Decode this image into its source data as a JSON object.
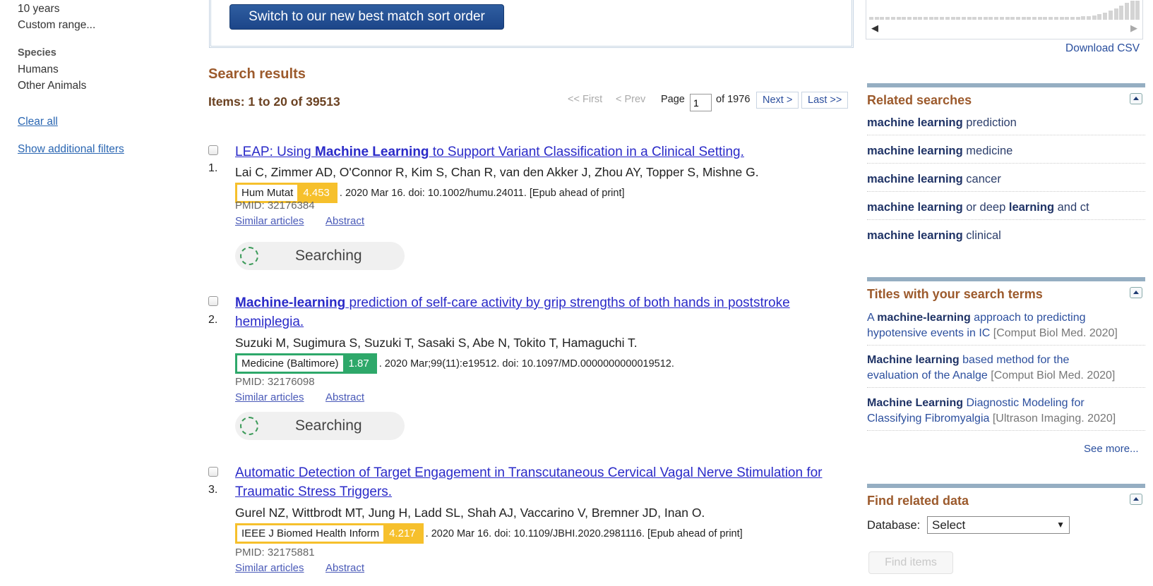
{
  "sidebar": {
    "years_10": "10 years",
    "custom_range": "Custom range...",
    "species_heading": "Species",
    "species_humans": "Humans",
    "species_other": "Other Animals",
    "clear_all": "Clear all",
    "show_filters": "Show additional filters"
  },
  "banner": {
    "button": "Switch to our new best match sort order"
  },
  "results": {
    "heading": "Search results",
    "count": "Items: 1 to 20 of 39513",
    "pager": {
      "first": "<< First",
      "prev": "< Prev",
      "page_label": "Page",
      "page_value": "1",
      "of_total": "of 1976",
      "next": "Next >",
      "last": "Last >>"
    },
    "similar_label": "Similar articles",
    "abstract_label": "Abstract",
    "searching_label": "Searching",
    "items": [
      {
        "num": "1.",
        "title_pre": "LEAP: Using ",
        "title_bold": "Machine Learning",
        "title_line1_post": " to Support Variant Classification in a Clinical Setting.",
        "authors": "Lai C, Zimmer AD, O'Connor R, Kim S, Chan R, van den Akker J, Zhou AY, Topper S, Mishne G.",
        "journal": "Hum Mutat",
        "score": "4.453",
        "citation": ". 2020 Mar 16. doi: 10.1002/humu.24011. [Epub ahead of print]",
        "pmid": "PMID: 32176384"
      },
      {
        "num": "2.",
        "title_bold": "Machine-learning",
        "title_line1_post": " prediction of self-care activity by grip strengths of both hands in poststroke",
        "title_line2": "hemiplegia.",
        "authors": "Suzuki M, Sugimura S, Suzuki T, Sasaki S, Abe N, Tokito T, Hamaguchi T.",
        "journal": "Medicine (Baltimore)",
        "score": "1.87",
        "citation": ". 2020 Mar;99(11):e19512. doi: 10.1097/MD.0000000000019512.",
        "pmid": "PMID: 32176098"
      },
      {
        "num": "3.",
        "title_line1": "Automatic Detection of Target Engagement in Transcutaneous Cervical Vagal Nerve Stimulation for",
        "title_line2": "Traumatic Stress Triggers.",
        "authors": "Gurel NZ, Wittbrodt MT, Jung H, Ladd SL, Shah AJ, Vaccarino V, Bremner JD, Inan O.",
        "journal": "IEEE J Biomed Health Inform",
        "score": "4.217",
        "citation": ". 2020 Mar 16. doi: 10.1109/JBHI.2020.2981116. [Epub ahead of print]",
        "pmid": "PMID: 32175881"
      }
    ]
  },
  "right": {
    "download_csv": "Download CSV",
    "related_heading": "Related searches",
    "related": [
      {
        "bold": "machine learning",
        "rest": " prediction"
      },
      {
        "bold": "machine learning",
        "rest": " medicine"
      },
      {
        "bold": "machine learning",
        "rest": " cancer"
      },
      {
        "bold": "machine learning",
        "mid": " or deep ",
        "bold2": "learning",
        "rest": " and ct"
      },
      {
        "bold": "machine learning",
        "rest": " clinical"
      }
    ],
    "titles_heading": "Titles with your search terms",
    "titles": [
      {
        "pre": "A ",
        "bold": "machine-learning",
        "line1_rest": " approach to predicting",
        "line2": "hypotensive events in IC",
        "cite": " [Comput Biol Med. 2020]"
      },
      {
        "bold": "Machine learning",
        "line1_rest": " based method for the",
        "line2": "evaluation of the Analge",
        "cite": " [Comput Biol Med. 2020]"
      },
      {
        "bold": "Machine Learning",
        "line1_rest": " Diagnostic Modeling for",
        "line2": "Classifying Fibromyalgia",
        "cite": " [Ultrason Imaging. 2020]"
      }
    ],
    "see_more": "See more...",
    "find_heading": "Find related data",
    "database_label": "Database:",
    "database_value": "Select",
    "find_items": "Find items"
  },
  "colors": {
    "heading_brown": "#9c5a2c",
    "journal_yellow": "#f6c02c",
    "journal_green": "#2ea86a",
    "link_blue": "#2a2ac8",
    "section_bar": "#95aec2"
  }
}
